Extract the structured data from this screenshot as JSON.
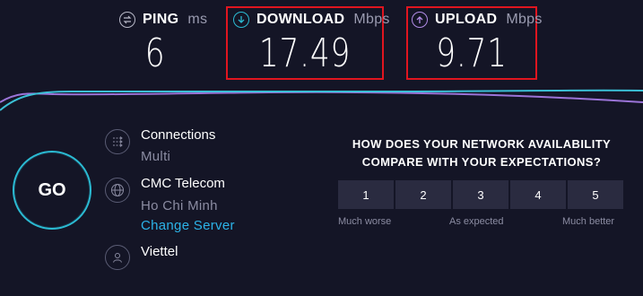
{
  "metrics": {
    "ping": {
      "label": "PING",
      "unit": "ms",
      "value": "6"
    },
    "download": {
      "label": "DOWNLOAD",
      "unit": "Mbps",
      "value": "17.49"
    },
    "upload": {
      "label": "UPLOAD",
      "unit": "Mbps",
      "value": "9.71"
    }
  },
  "go_button": {
    "label": "GO"
  },
  "info": {
    "connections": {
      "title": "Connections",
      "value": "Multi"
    },
    "server": {
      "name": "CMC Telecom",
      "location": "Ho Chi Minh",
      "change_label": "Change Server"
    },
    "provider": {
      "name": "Viettel"
    }
  },
  "survey": {
    "question_line1": "HOW DOES YOUR NETWORK AVAILABILITY",
    "question_line2": "COMPARE WITH YOUR EXPECTATIONS?",
    "options": [
      "1",
      "2",
      "3",
      "4",
      "5"
    ],
    "low_label": "Much worse",
    "mid_label": "As expected",
    "high_label": "Much better"
  },
  "colors": {
    "background": "#141526",
    "accent_cyan": "#2bbbd3",
    "accent_purple": "#b18be6",
    "highlight_red": "#e0151f",
    "link": "#2cb3e8"
  }
}
